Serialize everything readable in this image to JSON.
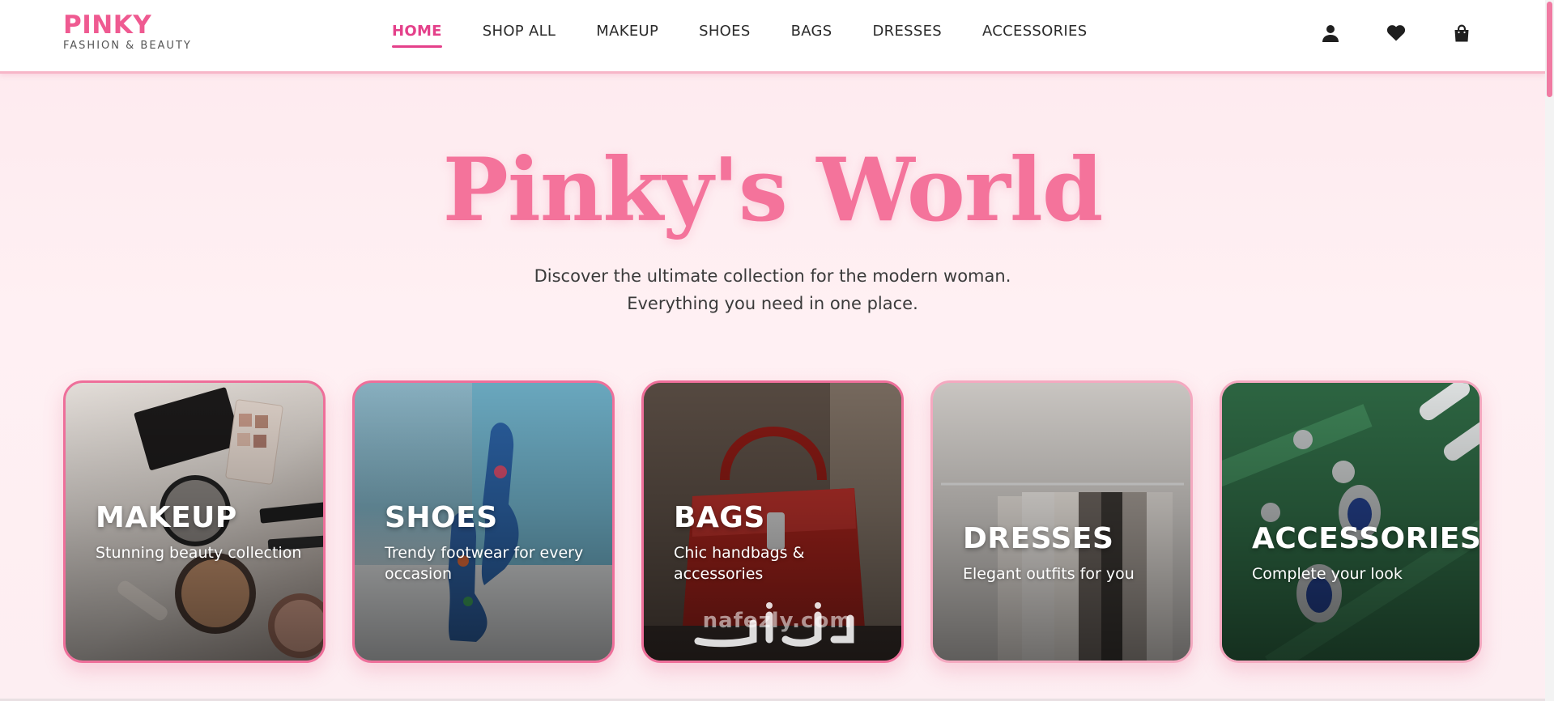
{
  "brand": {
    "name": "PINKY",
    "tagline": "FASHION & BEAUTY"
  },
  "nav": {
    "items": [
      {
        "label": "HOME",
        "active": true
      },
      {
        "label": "SHOP ALL",
        "active": false
      },
      {
        "label": "MAKEUP",
        "active": false
      },
      {
        "label": "SHOES",
        "active": false
      },
      {
        "label": "BAGS",
        "active": false
      },
      {
        "label": "DRESSES",
        "active": false
      },
      {
        "label": "ACCESSORIES",
        "active": false
      }
    ]
  },
  "header_icons": [
    "user-icon",
    "heart-icon",
    "shopping-bag-icon"
  ],
  "hero": {
    "title": "Pinky's World",
    "subtitle_line1": "Discover the ultimate collection for the modern woman.",
    "subtitle_line2": "Everything you need in one place."
  },
  "categories": [
    {
      "title": "MAKEUP",
      "description": "Stunning beauty collection",
      "image": "makeup-photo"
    },
    {
      "title": "SHOES",
      "description": "Trendy footwear for every occasion",
      "image": "shoes-photo"
    },
    {
      "title": "BAGS",
      "description": "Chic handbags & accessories",
      "image": "bags-photo"
    },
    {
      "title": "DRESSES",
      "description": "Elegant outfits for you",
      "image": "dresses-photo"
    },
    {
      "title": "ACCESSORIES",
      "description": "Complete your look",
      "image": "accessories-photo"
    }
  ],
  "watermark": {
    "text": "nafezly.com"
  },
  "colors": {
    "brand_pink": "#ef5a91",
    "active_nav": "#e4408a",
    "hero_title": "#f4739b",
    "card_border": "#ee6f9a",
    "page_background": "#fdeef2"
  }
}
